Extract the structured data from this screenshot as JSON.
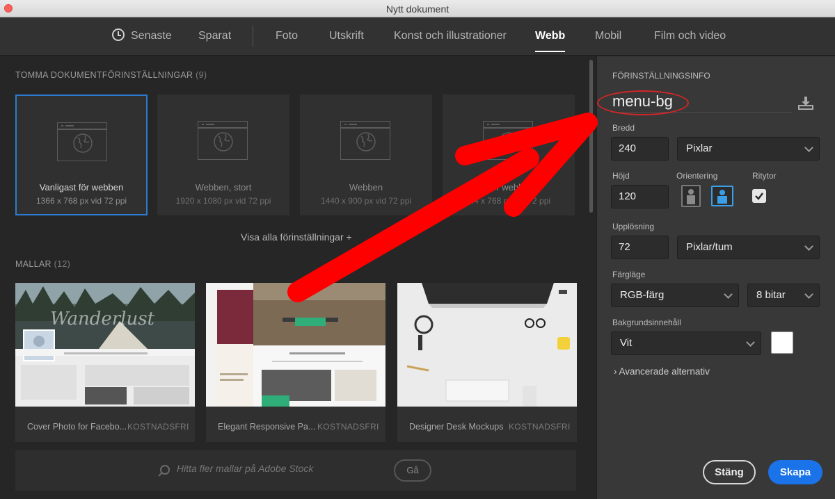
{
  "window": {
    "title": "Nytt dokument"
  },
  "tabs": [
    {
      "label": "Senaste"
    },
    {
      "label": "Sparat"
    },
    {
      "label": "Foto"
    },
    {
      "label": "Utskrift"
    },
    {
      "label": "Konst och illustrationer"
    },
    {
      "label": "Webb",
      "active": true
    },
    {
      "label": "Mobil"
    },
    {
      "label": "Film och video"
    }
  ],
  "blank_presets": {
    "title": "TOMMA DOKUMENTFÖRINSTÄLLNINGAR",
    "count": "(9)",
    "items": [
      {
        "name": "Vanligast för webben",
        "size": "1366 x 768 px vid 72 ppi",
        "selected": true
      },
      {
        "name": "Webben, stort",
        "size": "1920 x 1080 px vid 72 ppi"
      },
      {
        "name": "Webben",
        "size": "1440 x 900 px vid 72 ppi"
      },
      {
        "name": "...or webben",
        "size": "...4 x 768 px vid 72 ppi"
      }
    ],
    "show_all": "Visa alla förinställningar +"
  },
  "templates": {
    "title": "MALLAR",
    "count": "(12)",
    "items": [
      {
        "name": "Cover Photo for Facebo...",
        "badge": "KOSTNADSFRI",
        "thumb_text": "Wanderlust"
      },
      {
        "name": "Elegant Responsive Pa...",
        "badge": "KOSTNADSFRI"
      },
      {
        "name": "Designer Desk Mockups",
        "badge": "KOSTNADSFRI"
      }
    ]
  },
  "search": {
    "placeholder": "Hitta fler mallar på Adobe Stock",
    "go_label": "Gå"
  },
  "preset_info": {
    "section_title": "FÖRINSTÄLLNINGSINFO",
    "name": "menu-bg",
    "width_label": "Bredd",
    "width_value": "240",
    "width_unit": "Pixlar",
    "height_label": "Höjd",
    "height_value": "120",
    "orientation_label": "Orientering",
    "artboards_label": "Ritytor",
    "resolution_label": "Upplösning",
    "resolution_value": "72",
    "resolution_unit": "Pixlar/tum",
    "color_mode_label": "Färgläge",
    "color_mode_value": "RGB-färg",
    "bit_depth_value": "8 bitar",
    "background_label": "Bakgrundsinnehåll",
    "background_value": "Vit",
    "advanced_label": "Avancerade alternativ",
    "close_label": "Stäng",
    "create_label": "Skapa"
  },
  "colors": {
    "accent": "#1a73e8",
    "selection_border": "#2c7bd1",
    "annotation_red": "#ff0000"
  }
}
